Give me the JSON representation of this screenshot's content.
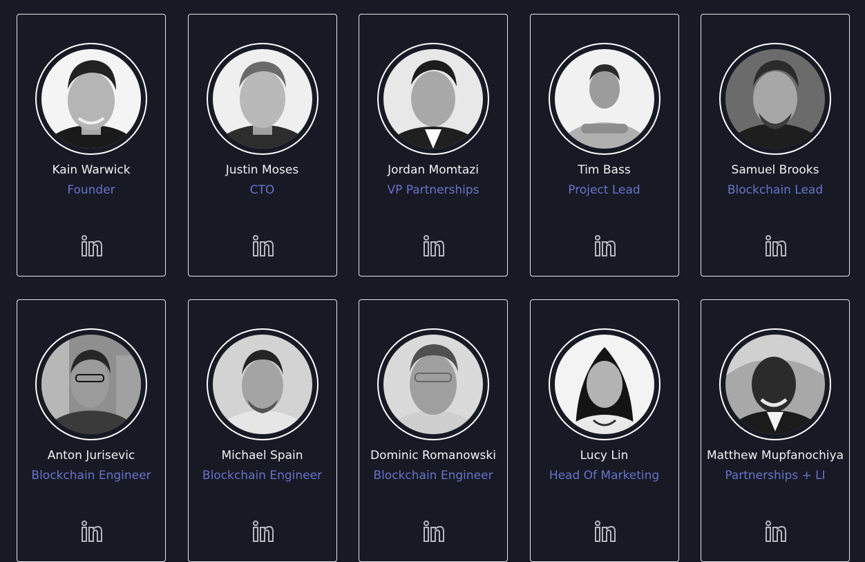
{
  "team": {
    "members": [
      {
        "name": "Kain Warwick",
        "role": "Founder",
        "linkedin_icon": "linkedin-icon"
      },
      {
        "name": "Justin Moses",
        "role": "CTO",
        "linkedin_icon": "linkedin-icon"
      },
      {
        "name": "Jordan Momtazi",
        "role": "VP Partnerships",
        "linkedin_icon": "linkedin-icon"
      },
      {
        "name": "Tim Bass",
        "role": "Project Lead",
        "linkedin_icon": "linkedin-icon"
      },
      {
        "name": "Samuel Brooks",
        "role": "Blockchain Lead",
        "linkedin_icon": "linkedin-icon"
      },
      {
        "name": "Anton Jurisevic",
        "role": "Blockchain Engineer",
        "linkedin_icon": "linkedin-icon"
      },
      {
        "name": "Michael Spain",
        "role": "Blockchain Engineer",
        "linkedin_icon": "linkedin-icon"
      },
      {
        "name": "Dominic Romanowski",
        "role": "Blockchain Engineer",
        "linkedin_icon": "linkedin-icon"
      },
      {
        "name": "Lucy Lin",
        "role": "Head Of Marketing",
        "linkedin_icon": "linkedin-icon"
      },
      {
        "name": "Matthew Mupfanochiya",
        "role": "Partnerships + LI",
        "linkedin_icon": "linkedin-icon"
      }
    ]
  },
  "colors": {
    "background": "#171a25",
    "card_border": "#e6e7ec",
    "name_text": "#f2f3f5",
    "role_text": "#6873c8",
    "icon": "#b8bac2"
  }
}
